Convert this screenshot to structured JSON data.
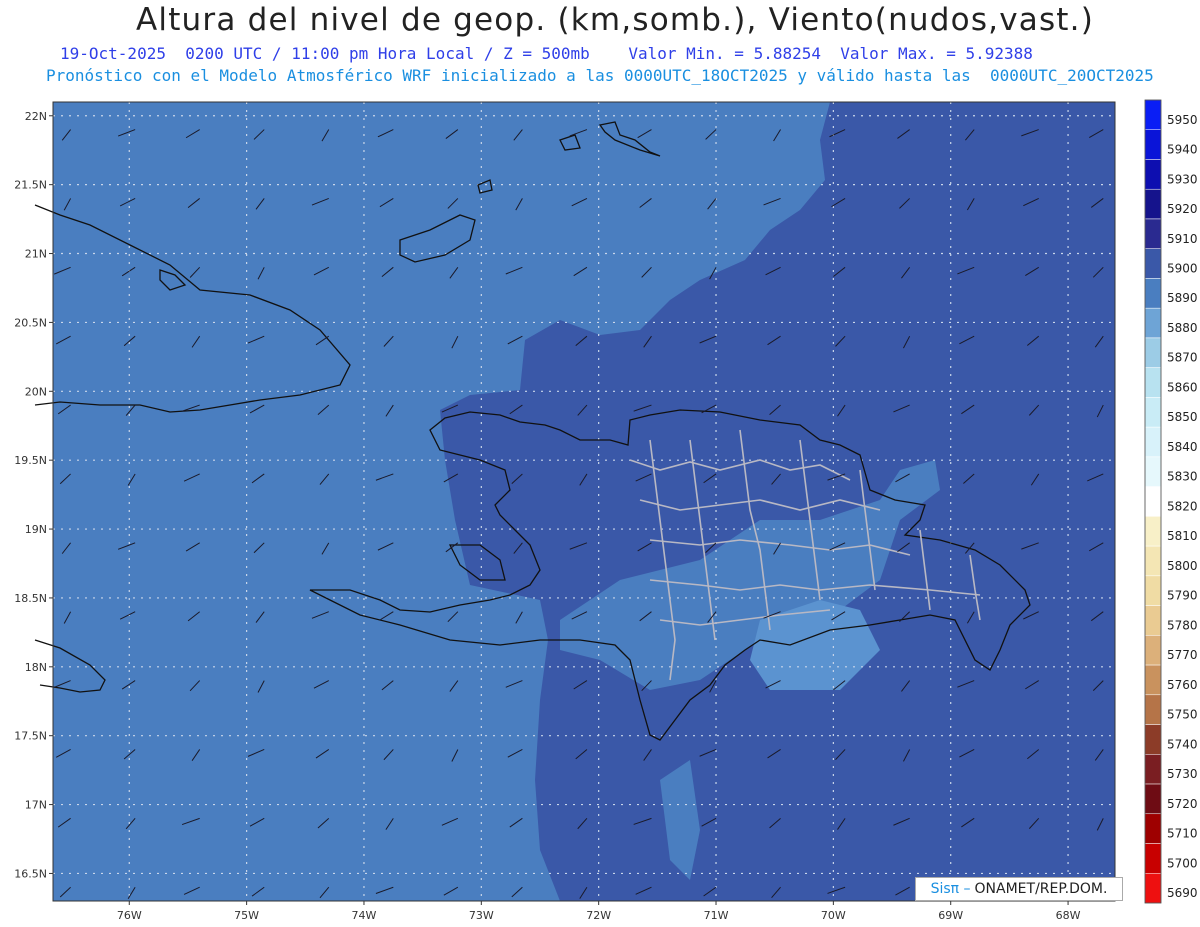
{
  "header": {
    "title": "Altura del nivel de geop. (km,somb.), Viento(nudos,vast.)",
    "subtitle1": "19-Oct-2025  0200 UTC / 11:00 pm Hora Local / Z = 500mb    Valor Min. = 5.88254  Valor Max. = 5.92388",
    "subtitle2": "Pronóstico con el Modelo Atmosférico WRF inicializado a las 0000UTC_18OCT2025 y válido hasta las  0000UTC_20OCT2025"
  },
  "map": {
    "lat_labels": [
      "22N",
      "21.5N",
      "21N",
      "20.5N",
      "20N",
      "19.5N",
      "19N",
      "18.5N",
      "18N",
      "17.5N",
      "17N",
      "16.5N"
    ],
    "lon_labels": [
      "76W",
      "75W",
      "74W",
      "73W",
      "72W",
      "71W",
      "70W",
      "69W",
      "68W"
    ],
    "lat_values": [
      22,
      21.5,
      21,
      20.5,
      20,
      19.5,
      19,
      18.5,
      18,
      17.5,
      17,
      16.5
    ],
    "lon_values": [
      -76,
      -75,
      -74,
      -73,
      -72,
      -71,
      -70,
      -69,
      -68
    ],
    "fill_colors": {
      "level_5890": "#4a7ec0",
      "level_5900": "#3a58a8",
      "level_5880": "#5b93d0"
    }
  },
  "colorbar": {
    "levels": [
      "5950",
      "5940",
      "5930",
      "5920",
      "5910",
      "5900",
      "5890",
      "5880",
      "5870",
      "5860",
      "5850",
      "5840",
      "5830",
      "5820",
      "5810",
      "5800",
      "5790",
      "5780",
      "5770",
      "5760",
      "5750",
      "5740",
      "5730",
      "5720",
      "5710",
      "5700",
      "5690"
    ],
    "colors": [
      "#0a1ef5",
      "#0a14d8",
      "#0d0eb0",
      "#15138c",
      "#2a2a90",
      "#3a58a8",
      "#4a7ec0",
      "#6ea4d6",
      "#9ccce6",
      "#b8e2f0",
      "#c9ecf6",
      "#d8f2fa",
      "#e6f8fc",
      "#ffffff",
      "#f8f0c8",
      "#f4e6b4",
      "#f0dca4",
      "#eacb92",
      "#dcb07a",
      "#c9925e",
      "#b57448",
      "#8c3c28",
      "#7a1e22",
      "#6e0c14",
      "#9e0000",
      "#c80000",
      "#ee1010"
    ]
  },
  "credit": {
    "brand": "Sisπ –",
    "org": "ONAMET/REP.DOM."
  }
}
